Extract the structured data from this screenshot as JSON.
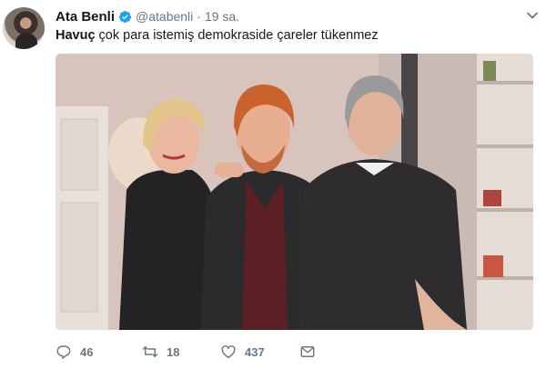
{
  "tweet": {
    "author_name": "Ata Benli",
    "handle": "@atabenli",
    "separator": "·",
    "time": "19 sa.",
    "hashtag": "Havuç",
    "text_rest": " çok para istemiş demokraside çareler tükenmez",
    "verified_color": "#1da1f2"
  },
  "icons": {
    "avatar": "avatar",
    "verified": "verified-badge-icon",
    "menu": "chevron-down-icon",
    "reply": "reply-icon",
    "retweet": "retweet-icon",
    "like": "heart-icon",
    "message": "envelope-icon"
  },
  "actions": {
    "replies": "46",
    "retweets": "18",
    "likes": "437"
  }
}
